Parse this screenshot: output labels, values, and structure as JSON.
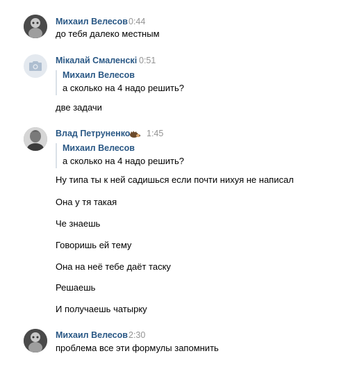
{
  "messages": [
    {
      "author": "Михаил Велесов",
      "time": "0:44",
      "lines": [
        "до тебя далеко местным"
      ]
    },
    {
      "author": "Мікалай Смаленскі",
      "time": "0:51",
      "quote": {
        "author": "Михаил Велесов",
        "text": "а сколько на 4 надо решить?"
      },
      "lines": [
        "две задачи"
      ]
    },
    {
      "author": "Влад Петруненко",
      "author_emoji": "hedgehog-emoji",
      "time": "1:45",
      "quote": {
        "author": "Михаил Велесов",
        "text": "а сколько на 4 надо решить?"
      },
      "lines": [
        "Ну типа ты к ней садишься если почти нихуя не написал",
        "Она у тя такая",
        "Че знаешь",
        "Говоришь ей тему",
        "Она на неё тебе даёт таску",
        "Решаешь",
        "И получаешь чатырку"
      ]
    },
    {
      "author": "Михаил Велесов",
      "time": "2:30",
      "lines": [
        "проблема все эти формулы запомнить"
      ]
    }
  ],
  "colors": {
    "link": "#2a5885",
    "time": "#939393",
    "quote_border": "#dae1e8",
    "camera_bg": "#e4e9ef"
  }
}
